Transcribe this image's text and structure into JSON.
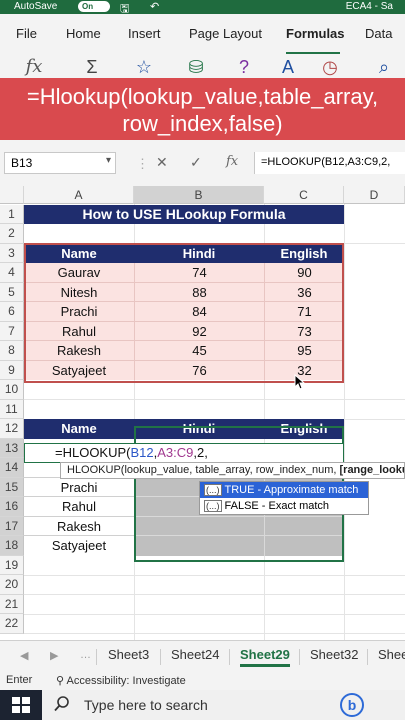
{
  "titlebar": {
    "autosave": "AutoSave",
    "toggle": "On",
    "file": "ECA4 - Sa"
  },
  "ribbon": {
    "tabs": [
      "File",
      "Home",
      "Insert",
      "Page Layout",
      "Formulas",
      "Data"
    ],
    "active_tab": "Formulas",
    "icon_names": [
      "function-icon",
      "sum-icon",
      "star-icon",
      "database-icon",
      "help-icon",
      "text-icon",
      "clock-icon",
      "lookup-icon"
    ]
  },
  "banner": {
    "line1": "=Hlookup(lookup_value,table_array,",
    "line2": "row_index,false)"
  },
  "formula_bar": {
    "name_box": "B13",
    "formula": "=HLOOKUP(B12,A3:C9,2,"
  },
  "grid": {
    "columns": [
      "A",
      "B",
      "C",
      "D"
    ],
    "rows": [
      "1",
      "2",
      "3",
      "4",
      "5",
      "6",
      "7",
      "8",
      "9",
      "10",
      "11",
      "12",
      "13",
      "14",
      "15",
      "16",
      "17",
      "18",
      "19",
      "20",
      "21",
      "22"
    ],
    "title": "How to USE HLookup Formula",
    "table_headers": [
      "Name",
      "Hindi",
      "English"
    ],
    "table_rows": [
      [
        "Gaurav",
        "74",
        "90"
      ],
      [
        "Nitesh",
        "88",
        "36"
      ],
      [
        "Prachi",
        "84",
        "71"
      ],
      [
        "Rahul",
        "92",
        "73"
      ],
      [
        "Rakesh",
        "45",
        "95"
      ],
      [
        "Satyajeet",
        "76",
        "32"
      ]
    ],
    "lookup_headers": [
      "Name",
      "Hindi",
      "English"
    ],
    "lookup_names": [
      "Prachi",
      "Rahul",
      "Rakesh",
      "Satyajeet"
    ],
    "edit_prefix": "=HLOOKUP(",
    "edit_ref1": "B12",
    "edit_comma": ",",
    "edit_ref2": "A3:C9",
    "edit_suffix": ",2,",
    "tooltip_text": "HLOOKUP(lookup_value, table_array, row_index_num, ",
    "tooltip_bold": "[range_lookup])",
    "dropdown": [
      {
        "tag": "(...)",
        "label": "TRUE - Approximate match"
      },
      {
        "tag": "(...)",
        "label": "FALSE - Exact match"
      }
    ]
  },
  "sheets": {
    "tabs": [
      "Sheet3",
      "Sheet24",
      "Sheet29",
      "Sheet32",
      "Shee"
    ],
    "active": "Sheet29"
  },
  "status": {
    "mode": "Enter",
    "accessibility": "Accessibility: Investigate"
  },
  "taskbar": {
    "search_placeholder": "Type here to search",
    "bing": "b"
  },
  "colors": {
    "excel_green": "#217346",
    "banner_red": "#d94a4e",
    "header_navy": "#1f2d6e",
    "pink_fill": "#fbe3e1"
  }
}
